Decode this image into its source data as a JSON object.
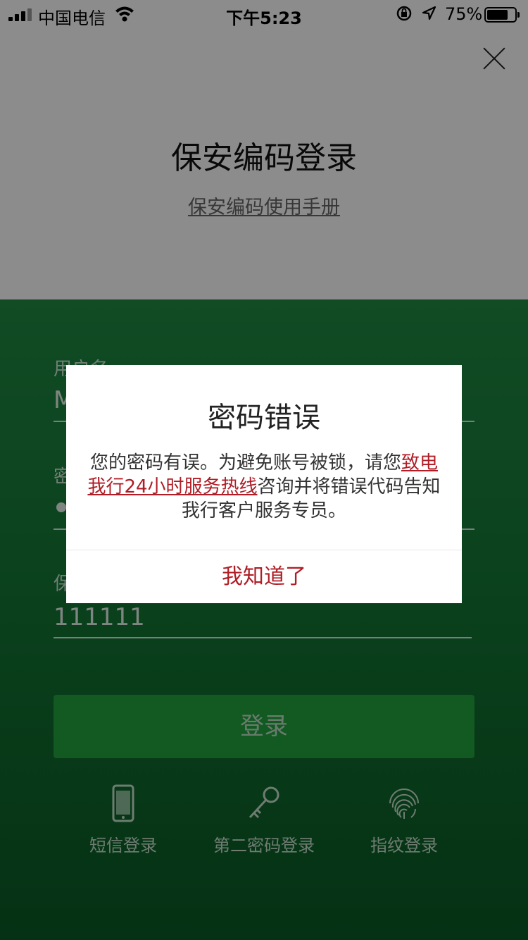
{
  "status_bar": {
    "carrier": "中国电信",
    "time": "下午5:23",
    "battery_percent": "75%",
    "battery_level": 0.75,
    "icons": [
      "signal-icon",
      "wifi-icon",
      "rotation-lock-icon",
      "location-arrow-icon",
      "battery-icon"
    ]
  },
  "header": {
    "title": "保安编码登录",
    "manual_link": "保安编码使用手册",
    "close_icon": "close-icon"
  },
  "form": {
    "username_label": "用户名",
    "username_value": "M",
    "password_label": "密",
    "security_code_label": "保",
    "security_code_value": "111111",
    "login_button": "登录"
  },
  "alt_logins": [
    {
      "label": "短信登录",
      "icon": "phone-icon"
    },
    {
      "label": "第二密码登录",
      "icon": "key-icon"
    },
    {
      "label": "指纹登录",
      "icon": "fingerprint-icon"
    }
  ],
  "dialog": {
    "title": "密码错误",
    "message_part1": "您的密码有误。为避免账号被锁，请您",
    "message_link": "致电我行24小时服务热线",
    "message_part2": "咨询并将错误代码告知我行客户服务专员。",
    "confirm_button": "我知道了"
  },
  "colors": {
    "accent_red": "#b01d26",
    "green": "#167a38",
    "login_button": "#22a33f"
  }
}
